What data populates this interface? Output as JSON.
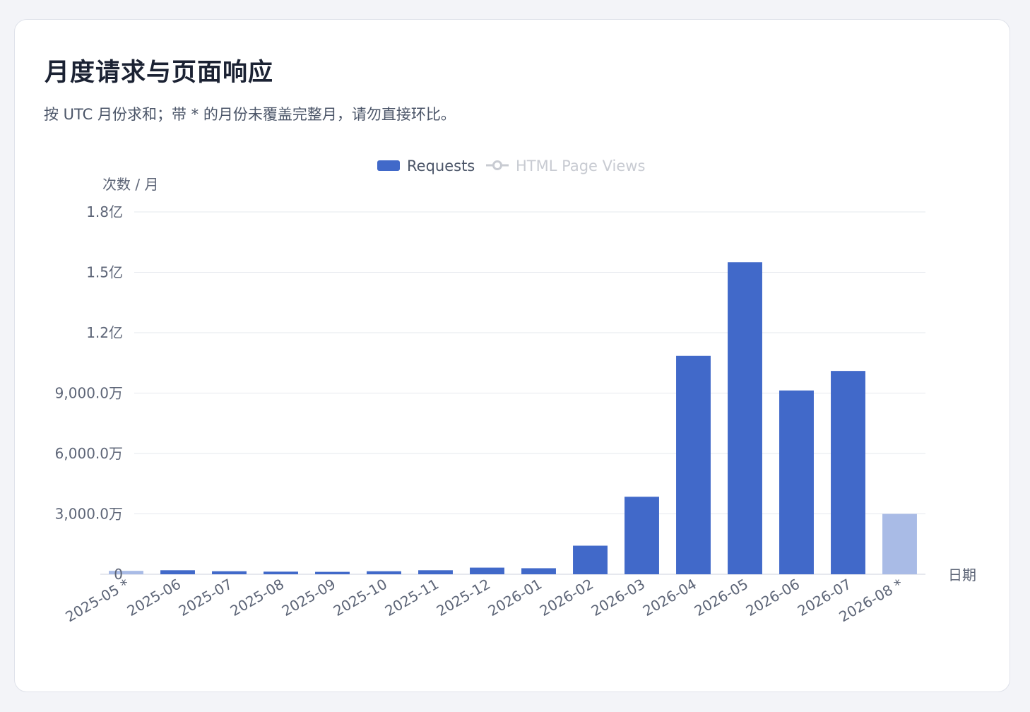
{
  "card": {
    "title": "月度请求与页面响应",
    "subtitle": "按 UTC 月份求和；带 * 的月份未覆盖完整月，请勿直接环比。"
  },
  "colors": {
    "primary": "#4169c9",
    "partial": "#a9bbe6",
    "disabled": "#c8cbd2",
    "grid": "#e6e8ee",
    "axis": "#dde1e8"
  },
  "chart_data": {
    "type": "bar",
    "categories": [
      "2025-05 *",
      "2025-06",
      "2025-07",
      "2025-08",
      "2025-09",
      "2025-10",
      "2025-11",
      "2025-12",
      "2026-01",
      "2026-02",
      "2026-03",
      "2026-04",
      "2026-05",
      "2026-06",
      "2026-07",
      "2026-08 *"
    ],
    "partial": [
      true,
      false,
      false,
      false,
      false,
      false,
      false,
      false,
      false,
      false,
      false,
      false,
      false,
      false,
      false,
      true
    ],
    "series": [
      {
        "name": "Requests",
        "values": [
          1700000,
          2000000,
          1500000,
          1300000,
          1200000,
          1500000,
          2000000,
          3300000,
          3000000,
          14200000,
          38500000,
          108500000,
          155000000,
          91300000,
          101000000,
          30000000
        ]
      }
    ],
    "legend": [
      {
        "label": "Requests",
        "active": true
      },
      {
        "label": "HTML Page Views",
        "active": false
      }
    ],
    "ylabel": "次数 / 月",
    "xlabel": "日期",
    "ylim": [
      0,
      180000000
    ],
    "yticks": [
      0,
      30000000,
      60000000,
      90000000,
      120000000,
      150000000,
      180000000
    ],
    "ytick_labels": [
      "0",
      "3,000.0万",
      "6,000.0万",
      "9,000.0万",
      "1.2亿",
      "1.5亿",
      "1.8亿"
    ],
    "grid": true,
    "legend_position": "top-center"
  }
}
